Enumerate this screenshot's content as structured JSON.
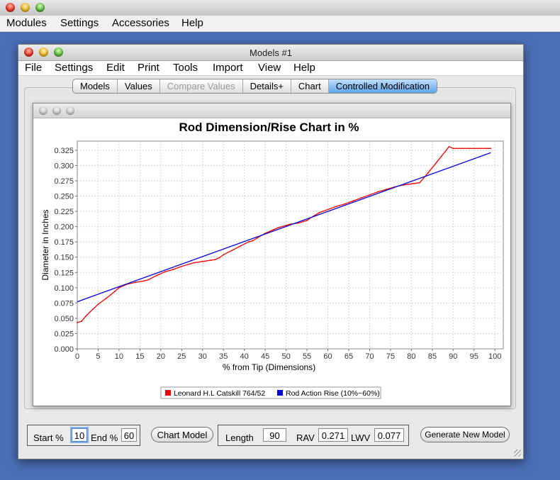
{
  "app_menu": [
    "Modules",
    "Settings",
    "Accessories",
    "Help"
  ],
  "window": {
    "title": "Models #1",
    "menu": [
      "File",
      "Settings",
      "Edit",
      "Print",
      "Tools",
      "Import",
      "View",
      "Help"
    ]
  },
  "tabs": [
    {
      "label": "Models",
      "state": "normal"
    },
    {
      "label": "Values",
      "state": "normal"
    },
    {
      "label": "Compare Values",
      "state": "disabled"
    },
    {
      "label": "Details+",
      "state": "normal"
    },
    {
      "label": "Chart",
      "state": "normal"
    },
    {
      "label": "Controlled Modification",
      "state": "active"
    }
  ],
  "chart_data": {
    "type": "line",
    "title": "Rod Dimension/Rise Chart in %",
    "xlabel": "% from Tip (Dimensions)",
    "ylabel": "Diameter in Inches",
    "xlim": [
      0,
      102
    ],
    "ylim": [
      0,
      0.34
    ],
    "xticks": [
      0,
      5,
      10,
      15,
      20,
      25,
      30,
      35,
      40,
      45,
      50,
      55,
      60,
      65,
      70,
      75,
      80,
      85,
      90,
      95,
      100
    ],
    "xtick_labels": [
      "0",
      "5",
      "10",
      "15",
      "20",
      "25",
      "30",
      "35",
      "40",
      "45",
      "50",
      "55",
      "60",
      "65",
      "70",
      "75",
      "80",
      "85",
      "90",
      "95",
      "100"
    ],
    "yticks": [
      0,
      0.025,
      0.05,
      0.075,
      0.1,
      0.125,
      0.15,
      0.175,
      0.2,
      0.225,
      0.25,
      0.275,
      0.3,
      0.325
    ],
    "ytick_labels": [
      "0.000",
      "0.025",
      "0.050",
      "0.075",
      "0.100",
      "0.125",
      "0.150",
      "0.175",
      "0.200",
      "0.225",
      "0.250",
      "0.275",
      "0.300",
      "0.325"
    ],
    "grid": true,
    "legend_position": "bottom",
    "series": [
      {
        "name": "Leonard H.L Catskill 764/52",
        "color": "#ee0000",
        "x": [
          0,
          1,
          2,
          3,
          5,
          7,
          9,
          10,
          12,
          14,
          16,
          17,
          19,
          21,
          23,
          25,
          27,
          28,
          30,
          32,
          33,
          34,
          35,
          37,
          39,
          41,
          42,
          43,
          45,
          47,
          48,
          50,
          51,
          53,
          55,
          56,
          58,
          60,
          62,
          64,
          66,
          68,
          70,
          72,
          74,
          76,
          78,
          80,
          82,
          84,
          86,
          88,
          89,
          90,
          92,
          94,
          96,
          98,
          99
        ],
        "y": [
          0.043,
          0.045,
          0.053,
          0.06,
          0.073,
          0.083,
          0.094,
          0.1,
          0.106,
          0.109,
          0.111,
          0.113,
          0.12,
          0.126,
          0.13,
          0.135,
          0.139,
          0.141,
          0.143,
          0.145,
          0.146,
          0.149,
          0.154,
          0.161,
          0.168,
          0.175,
          0.177,
          0.181,
          0.189,
          0.195,
          0.198,
          0.202,
          0.204,
          0.206,
          0.21,
          0.215,
          0.223,
          0.228,
          0.233,
          0.237,
          0.242,
          0.247,
          0.252,
          0.257,
          0.261,
          0.265,
          0.268,
          0.27,
          0.272,
          0.288,
          0.305,
          0.322,
          0.331,
          0.328,
          0.328,
          0.328,
          0.328,
          0.328,
          0.328
        ]
      },
      {
        "name": "Rod Action Rise (10%~60%)",
        "color": "#0000dd",
        "x": [
          0,
          99
        ],
        "y": [
          0.077,
          0.321
        ]
      }
    ]
  },
  "controls": {
    "start_label": "Start %",
    "start_value": "10",
    "end_label": "End %",
    "end_value": "60",
    "chart_model_button": "Chart Model",
    "length_label": "Length",
    "length_value": "90",
    "rav_label": "RAV",
    "rav_value": "0.271",
    "lwv_label": "LWV",
    "lwv_value": "0.077",
    "generate_button": "Generate New Model"
  }
}
